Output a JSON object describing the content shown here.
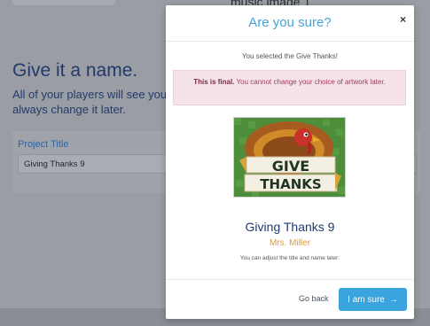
{
  "background": {
    "top_title": "music image 1",
    "heading": "Give it a name.",
    "subtext": "All of your players will see your always change it later.",
    "field_label": "Project Title",
    "field_value": "Giving Thanks 9"
  },
  "modal": {
    "title": "Are you sure?",
    "close_label": "×",
    "selected_text": "You selected the Give Thanks!",
    "alert_bold": "This is final.",
    "alert_text": " You cannot change your choice of artwork later.",
    "artwork": {
      "line1": "GIVE",
      "line2": "THANKS",
      "icon": "turkey-artwork-image"
    },
    "project_title": "Giving Thanks 9",
    "author": "Mrs. Miller",
    "hint": "You can adjust the title and name later:",
    "go_back_label": "Go back",
    "confirm_label": "I am sure",
    "confirm_icon": "arrow-right-icon"
  },
  "colors": {
    "accent": "#3aa4df",
    "title_blue": "#45a4d6",
    "project_title": "#1e3a6d",
    "author": "#e59a2a",
    "alert_bg": "#f6e2ea"
  }
}
